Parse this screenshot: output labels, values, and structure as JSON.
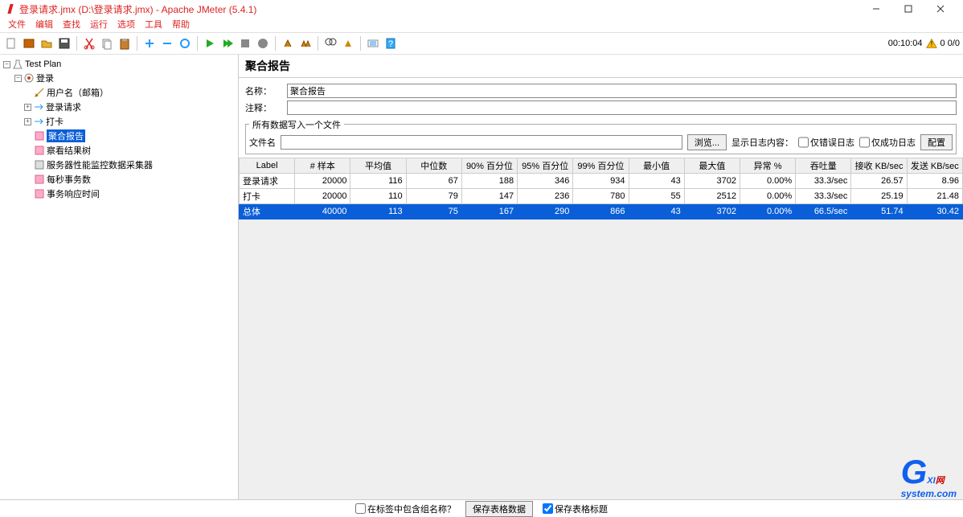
{
  "window": {
    "title": "登录请求.jmx (D:\\登录请求.jmx) - Apache JMeter (5.4.1)"
  },
  "menu": {
    "file": "文件",
    "edit": "编辑",
    "search": "查找",
    "run": "运行",
    "options": "选项",
    "tools": "工具",
    "help": "帮助"
  },
  "toolbar_right": {
    "timer": "00:10:04",
    "counter": "0  0/0"
  },
  "tree": {
    "root": "Test Plan",
    "login": "登录",
    "username": "用户名（邮箱）",
    "login_req": "登录请求",
    "checkin": "打卡",
    "agg_report": "聚合报告",
    "result_tree": "察看结果树",
    "perfmon": "服务器性能监控数据采集器",
    "tps": "每秒事务数",
    "response_time": "事务响应时间"
  },
  "panel": {
    "title": "聚合报告",
    "name_label": "名称：",
    "name_value": "聚合报告",
    "comment_label": "注释：",
    "comment_value": "",
    "fieldset_legend": "所有数据写入一个文件",
    "filename_label": "文件名",
    "filename_value": "",
    "browse_btn": "浏览...",
    "log_label": "显示日志内容：",
    "only_error": "仅错误日志",
    "only_success": "仅成功日志",
    "config_btn": "配置"
  },
  "headers": [
    "Label",
    "# 样本",
    "平均值",
    "中位数",
    "90% 百分位",
    "95% 百分位",
    "99% 百分位",
    "最小值",
    "最大值",
    "异常 %",
    "吞吐量",
    "接收 KB/sec",
    "发送 KB/sec"
  ],
  "rows": [
    {
      "label": "登录请求",
      "samples": "20000",
      "avg": "116",
      "median": "67",
      "p90": "188",
      "p95": "346",
      "p99": "934",
      "min": "43",
      "max": "3702",
      "err": "0.00%",
      "thru": "33.3/sec",
      "recv": "26.57",
      "sent": "8.96"
    },
    {
      "label": "打卡",
      "samples": "20000",
      "avg": "110",
      "median": "79",
      "p90": "147",
      "p95": "236",
      "p99": "780",
      "min": "55",
      "max": "2512",
      "err": "0.00%",
      "thru": "33.3/sec",
      "recv": "25.19",
      "sent": "21.48"
    },
    {
      "label": "总体",
      "samples": "40000",
      "avg": "113",
      "median": "75",
      "p90": "167",
      "p95": "290",
      "p99": "866",
      "min": "43",
      "max": "3702",
      "err": "0.00%",
      "thru": "66.5/sec",
      "recv": "51.74",
      "sent": "30.42",
      "total": true
    }
  ],
  "bottom": {
    "include_group": "在标签中包含组名称？",
    "save_data": "保存表格数据",
    "save_header": "保存表格标题"
  },
  "watermark": {
    "main": "XI",
    "g": "G",
    "sub": "system.com",
    "net": "网"
  }
}
